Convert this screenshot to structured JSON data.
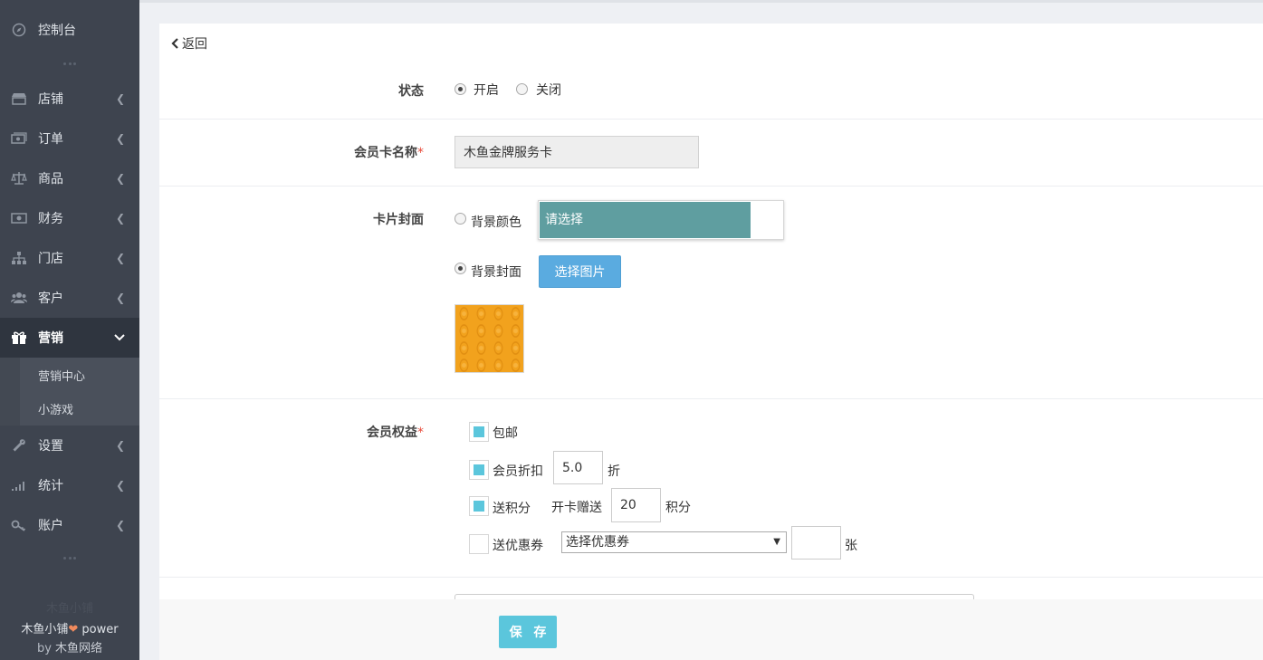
{
  "sidebar": {
    "items": [
      {
        "label": "控制台",
        "icon": "dashboard-icon"
      },
      {
        "label": "店铺",
        "icon": "store-icon"
      },
      {
        "label": "订单",
        "icon": "order-icon"
      },
      {
        "label": "商品",
        "icon": "scale-icon"
      },
      {
        "label": "财务",
        "icon": "money-icon"
      },
      {
        "label": "门店",
        "icon": "sitemap-icon"
      },
      {
        "label": "客户",
        "icon": "users-icon"
      },
      {
        "label": "营销",
        "icon": "gift-icon"
      },
      {
        "label": "设置",
        "icon": "wrench-icon"
      },
      {
        "label": "统计",
        "icon": "signal-icon"
      },
      {
        "label": "账户",
        "icon": "key-icon"
      }
    ],
    "subitems": [
      "营销中心",
      "小游戏"
    ],
    "footer_ghost": "木鱼小铺",
    "footer_line1_a": "木鱼小铺",
    "footer_line1_b": " power",
    "footer_line2_a": "by ",
    "footer_line2_b": "木鱼网络"
  },
  "form": {
    "back": "返回",
    "status_label": "状态",
    "status_on": "开启",
    "status_off": "关闭",
    "status_value": "开启",
    "name_label": "会员卡名称",
    "required_mark": "*",
    "name_value": "木鱼金牌服务卡",
    "cover_label": "卡片封面",
    "bg_color_label": "背景颜色",
    "color_placeholder": "请选择",
    "color_value": "#5f9ea0",
    "bg_cover_label": "背景封面",
    "choose_image": "选择图片",
    "cover_color": "#f2a21d",
    "benefits_label": "会员权益",
    "free_shipping": "包邮",
    "discount_label": "会员折扣",
    "discount_value": "5.0",
    "discount_unit": "折",
    "points_label": "送积分",
    "points_prefix": "开卡赠送",
    "points_value": "20",
    "points_unit": "积分",
    "coupon_label": "送优惠券",
    "coupon_select": "选择优惠券",
    "coupon_count": "",
    "coupon_unit": "张",
    "save": "保 存"
  }
}
